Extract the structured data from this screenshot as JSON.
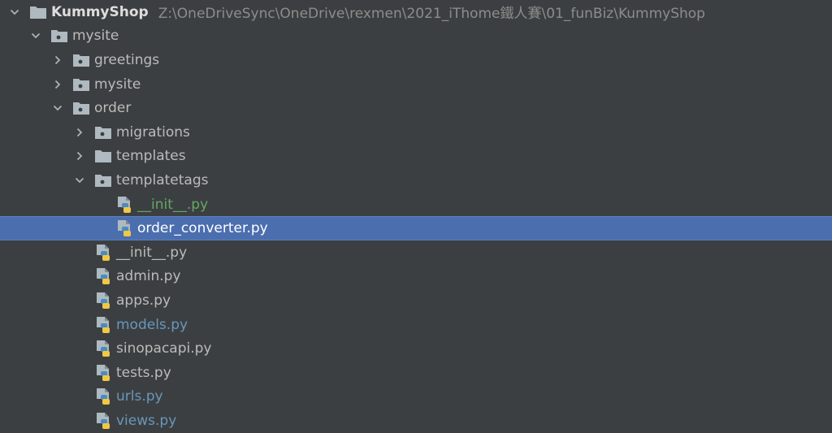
{
  "tree": {
    "root": {
      "name": "KummyShop",
      "path": "Z:\\OneDriveSync\\OneDrive\\rexmen\\2021_iThome鐵人賽\\01_funBiz\\KummyShop",
      "icon": "folder-icon"
    },
    "nodes": [
      {
        "label": "mysite",
        "icon": "module-folder-icon",
        "state": "expanded",
        "color": "#bbbbbb"
      },
      {
        "label": "greetings",
        "icon": "module-folder-icon",
        "state": "collapsed",
        "color": "#bbbbbb"
      },
      {
        "label": "mysite",
        "icon": "module-folder-icon",
        "state": "collapsed",
        "color": "#bbbbbb"
      },
      {
        "label": "order",
        "icon": "module-folder-icon",
        "state": "expanded",
        "color": "#bbbbbb"
      },
      {
        "label": "migrations",
        "icon": "module-folder-icon",
        "state": "collapsed",
        "color": "#bbbbbb"
      },
      {
        "label": "templates",
        "icon": "folder-icon",
        "state": "collapsed",
        "color": "#bbbbbb"
      },
      {
        "label": "templatetags",
        "icon": "module-folder-icon",
        "state": "expanded",
        "color": "#bbbbbb"
      },
      {
        "label": "__init__.py",
        "icon": "python-file-icon",
        "state": "file",
        "color": "#62a862"
      },
      {
        "label": "order_converter.py",
        "icon": "python-file-icon",
        "state": "file",
        "color": "#ffffff",
        "selected": true
      },
      {
        "label": "__init__.py",
        "icon": "python-file-icon",
        "state": "file",
        "color": "#bbbbbb"
      },
      {
        "label": "admin.py",
        "icon": "python-file-icon",
        "state": "file",
        "color": "#bbbbbb"
      },
      {
        "label": "apps.py",
        "icon": "python-file-icon",
        "state": "file",
        "color": "#bbbbbb"
      },
      {
        "label": "models.py",
        "icon": "python-file-icon",
        "state": "file",
        "color": "#6897bb"
      },
      {
        "label": "sinopacapi.py",
        "icon": "python-file-icon",
        "state": "file",
        "color": "#bbbbbb"
      },
      {
        "label": "tests.py",
        "icon": "python-file-icon",
        "state": "file",
        "color": "#bbbbbb"
      },
      {
        "label": "urls.py",
        "icon": "python-file-icon",
        "state": "file",
        "color": "#6897bb"
      },
      {
        "label": "views.py",
        "icon": "python-file-icon",
        "state": "file",
        "color": "#6897bb"
      }
    ]
  },
  "colors": {
    "background": "#3c3f41",
    "selection": "#4b6eaf",
    "text": "#bbbbbb",
    "path_text": "#8c8c8c",
    "modified_blue": "#6897bb",
    "added_green": "#62a862",
    "folder": "#aeb9c0"
  }
}
